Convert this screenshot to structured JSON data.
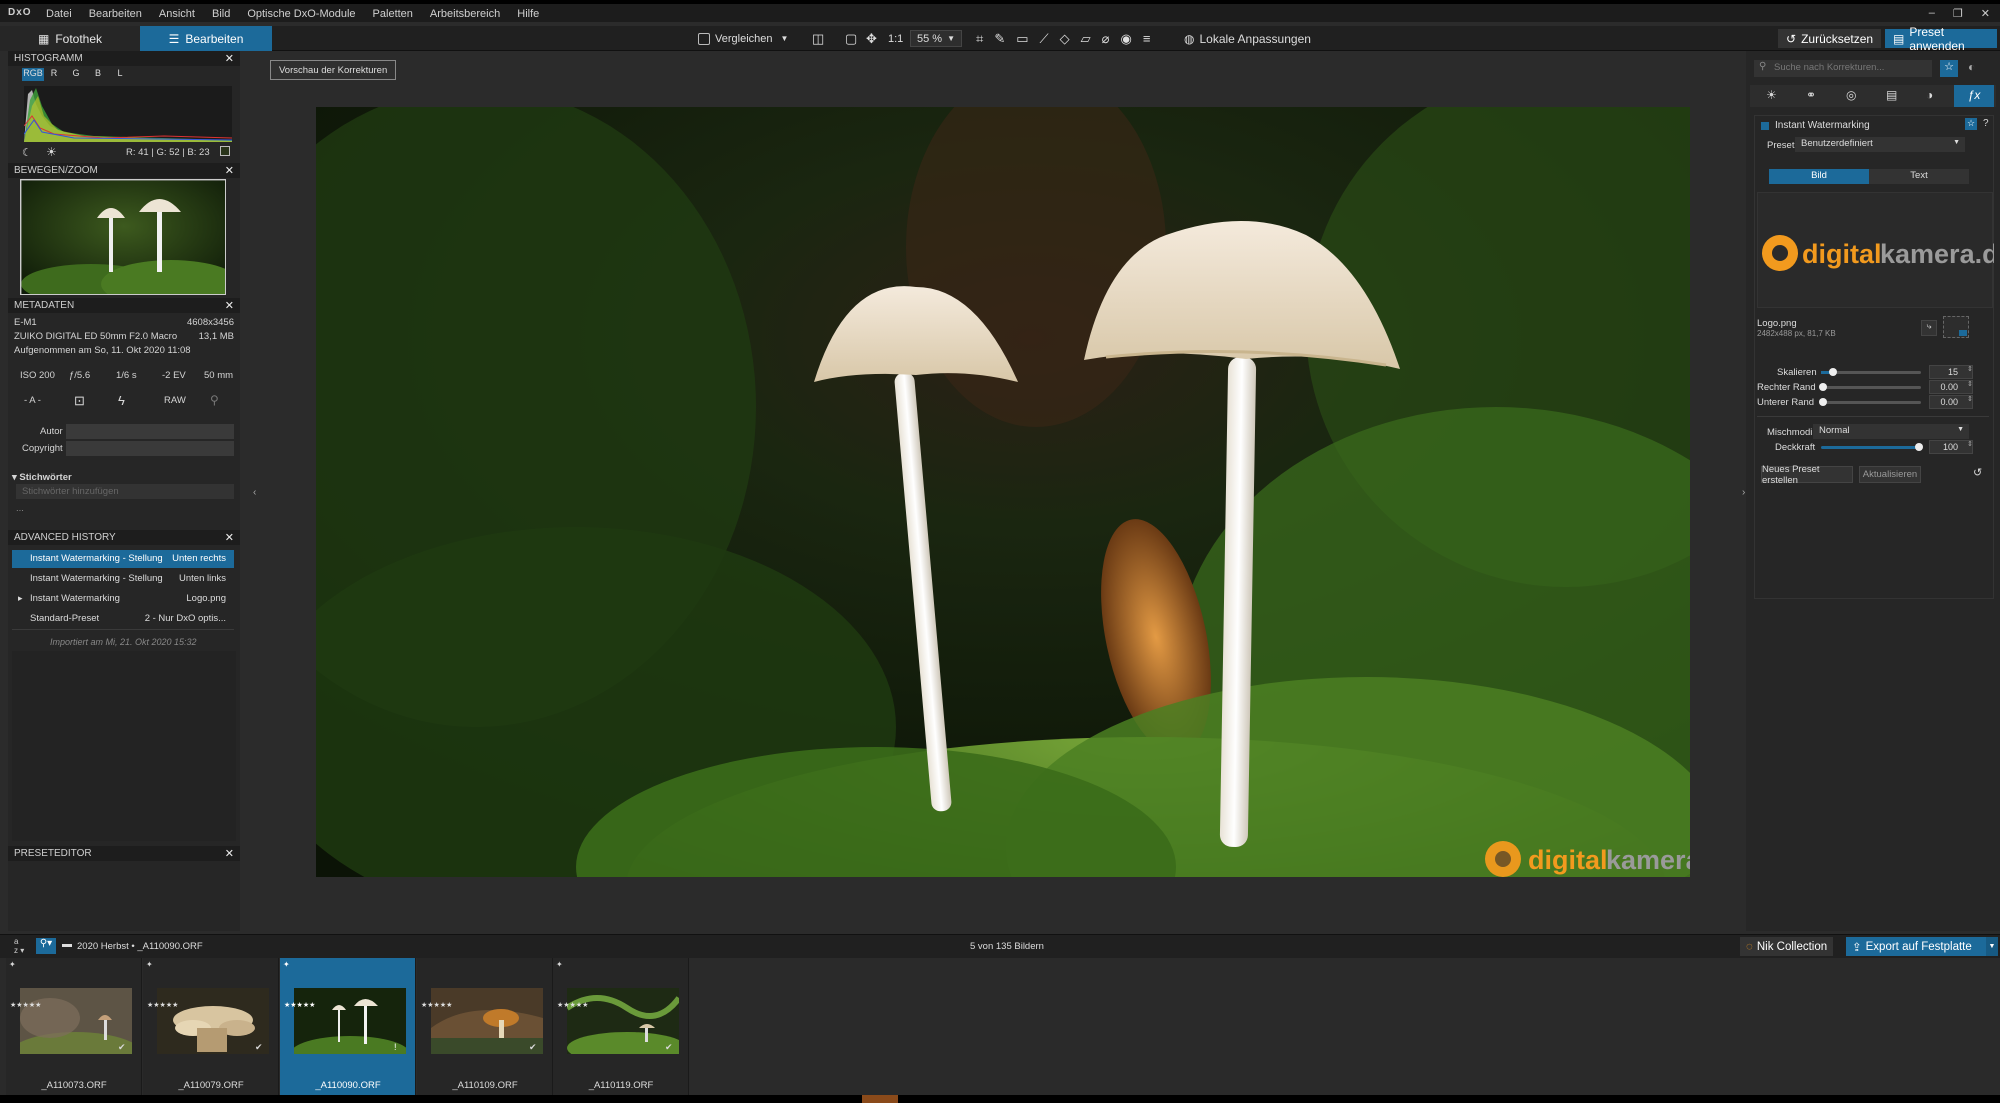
{
  "app": {
    "logo": "DxO",
    "menu": [
      "Datei",
      "Bearbeiten",
      "Ansicht",
      "Bild",
      "Optische DxO-Module",
      "Paletten",
      "Arbeitsbereich",
      "Hilfe"
    ],
    "window_controls": [
      "–",
      "❐",
      "✕"
    ]
  },
  "tabs": {
    "library": "Fotothek",
    "edit": "Bearbeiten"
  },
  "toolbar": {
    "compare": "Vergleichen",
    "ratio": "1:1",
    "zoom": "55 %",
    "local": "Lokale Anpassungen",
    "reset": "Zurücksetzen",
    "apply_preset": "Preset anwenden"
  },
  "preview_button": "Vorschau der Korrekturen",
  "histogram": {
    "title": "HISTOGRAMM",
    "channels": [
      "RGB",
      "R",
      "G",
      "B",
      "L"
    ],
    "readout": "R: 41 | G: 52 | B: 23"
  },
  "movezoom": {
    "title": "BEWEGEN/ZOOM"
  },
  "metadata": {
    "title": "METADATEN",
    "camera": "E-M1",
    "dims": "4608x3456",
    "lens": "ZUIKO DIGITAL ED 50mm F2.0 Macro",
    "size": "13,1 MB",
    "taken": "Aufgenommen am So, 11. Okt 2020 11:08",
    "exif": [
      "ISO 200",
      "ƒ/5.6",
      "1/6 s",
      "-2 EV",
      "50 mm"
    ],
    "modes": [
      "- A -",
      "",
      "",
      "RAW",
      ""
    ],
    "author_label": "Autor",
    "copyright_label": "Copyright",
    "keywords_label": "Stichwörter",
    "keywords_placeholder": "Stichwörter hinzufügen",
    "ellipsis": "..."
  },
  "history": {
    "title": "ADVANCED HISTORY",
    "rows": [
      {
        "name": "Instant Watermarking - Stellung",
        "value": "Unten rechts",
        "selected": true
      },
      {
        "name": "Instant Watermarking - Stellung",
        "value": "Unten links"
      },
      {
        "name": "Instant Watermarking",
        "value": "Logo.png",
        "expander": "▸"
      },
      {
        "name": "Standard-Preset",
        "value": "2 - Nur DxO optis..."
      }
    ],
    "imported": "Importiert am Mi, 21. Okt 2020 15:32"
  },
  "preseteditor": {
    "title": "PRESETEDITOR"
  },
  "right": {
    "search_placeholder": "Suche nach Korrekturen...",
    "module_title": "Instant Watermarking",
    "preset_label": "Preset",
    "preset_value": "Benutzerdefiniert",
    "seg_image": "Bild",
    "seg_text": "Text",
    "logo_file": "Logo.png",
    "logo_info": "2482x488 px, 81,7 KB",
    "scale_label": "Skalieren",
    "scale_value": "15",
    "right_margin_label": "Rechter Rand",
    "right_margin_value": "0.00",
    "bottom_margin_label": "Unterer Rand",
    "bottom_margin_value": "0.00",
    "blend_label": "Mischmodi",
    "blend_value": "Normal",
    "opacity_label": "Deckkraft",
    "opacity_value": "100",
    "new_preset": "Neues Preset erstellen",
    "update": "Aktualisieren"
  },
  "watermark": {
    "brand_a": "digital",
    "brand_b": "kamera.de"
  },
  "strip": {
    "path": "2020 Herbst",
    "file": "_A110090.ORF",
    "count": "5 von 135 Bildern",
    "nik": "Nik Collection",
    "export": "Export auf Festplatte"
  },
  "thumbs": [
    {
      "label": "_A110073.ORF"
    },
    {
      "label": "_A110079.ORF"
    },
    {
      "label": "_A110090.ORF",
      "selected": true
    },
    {
      "label": "_A110109.ORF"
    },
    {
      "label": "_A110119.ORF"
    }
  ],
  "colors": {
    "accent": "#1c6a9a",
    "orange": "#f29a1e"
  }
}
